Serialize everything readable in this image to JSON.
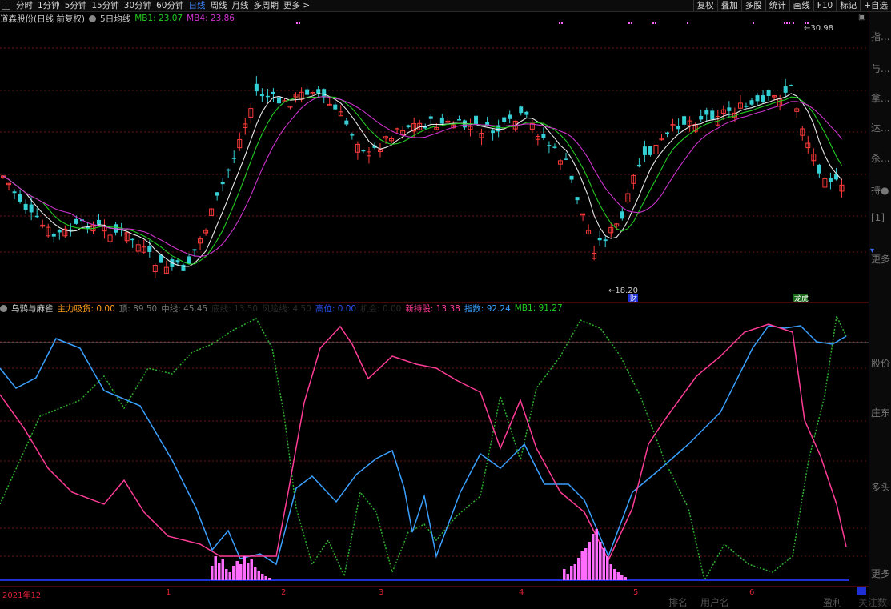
{
  "toolbar": {
    "periods": [
      "分时",
      "1分钟",
      "5分钟",
      "15分钟",
      "30分钟",
      "60分钟",
      "日线",
      "周线",
      "月线",
      "多周期",
      "更多 >"
    ],
    "active_period": "日线",
    "right_tools": [
      "复权",
      "叠加",
      "多股",
      "统计",
      "画线",
      "F10",
      "标记",
      "+自选"
    ]
  },
  "stock": {
    "name": "道森股份(日线 前复权)",
    "ma_title": "5日均线",
    "mb1_label": "MB1: 23.07",
    "mb4_label": "MB4: 23.86",
    "high_label": "30.98",
    "low_label": "18.20",
    "badge_left": "财",
    "badge_right": "龙虎"
  },
  "indicator": {
    "name": "乌鸦与麻雀",
    "main_line": "主力吸货: 0.00",
    "top": "顶: 89.50",
    "mid": "中线: 45.45",
    "bottom_hidden": "底线: 13.50",
    "hidden2": "风险线: 4.50",
    "lock": "高位: 0.00",
    "hidden3": "机会: 0.00",
    "retail": "新持股: 13.38",
    "index": "指数: 92.24",
    "mb1": "MB1: 91.27"
  },
  "axis": {
    "labels": [
      "2021年12",
      "1",
      "2",
      "3",
      "4",
      "5",
      "6"
    ]
  },
  "side_panel": {
    "items": [
      "指...",
      "与...",
      "拿...",
      "达...",
      "杀...",
      "持●",
      "[1]",
      "更多",
      "股价",
      "庄东",
      "多头",
      "更多"
    ]
  },
  "bottom_tabs": [
    "排名",
    "用户名",
    "盈利",
    "关注数"
  ],
  "colors": {
    "up": "#ff3b3b",
    "down": "#35d0d6",
    "ma5": "#e8e8e8",
    "mb1": "#22cc22",
    "mb4": "#cc33cc",
    "blue_line": "#3aa0ff",
    "pink_line": "#ff3c96",
    "green_dash": "#30b030",
    "bars": "#ff6cff"
  }
}
